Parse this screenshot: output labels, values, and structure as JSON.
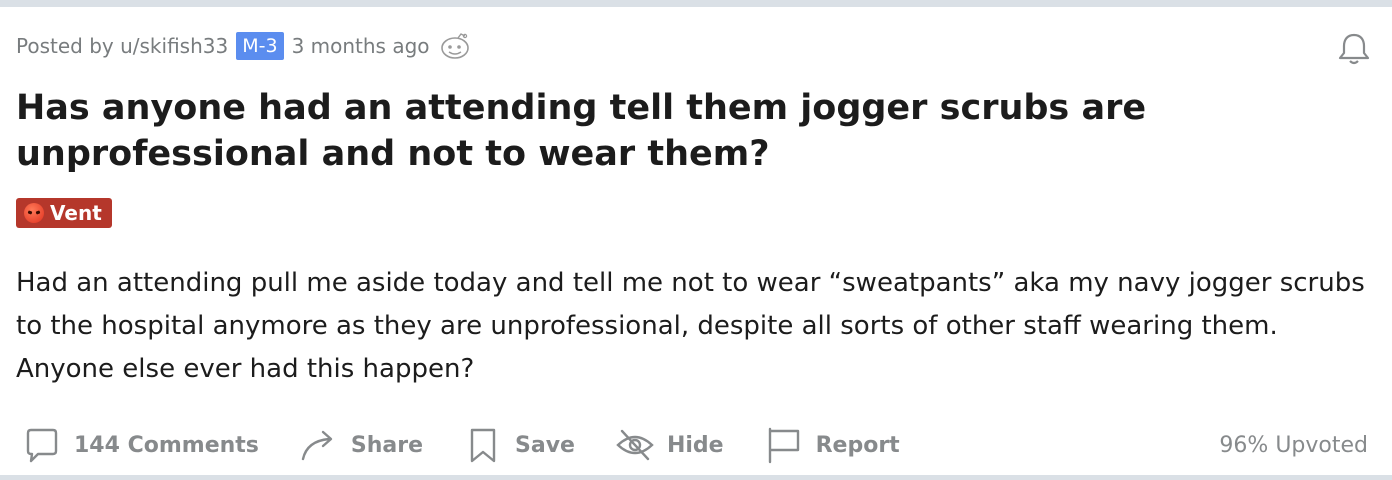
{
  "post": {
    "meta": {
      "posted_by": "Posted by u/skifish33",
      "user_flair": "M-3",
      "time_ago": "3 months ago"
    },
    "title": "Has anyone had an attending tell them jogger scrubs are unprofessional and not to wear them?",
    "flair": "Vent",
    "body_lines": [
      "Had an attending pull me aside today and tell me not to wear “sweatpants” aka my navy jogger scrubs",
      "to the hospital anymore as they are unprofessional, despite all sorts of other staff wearing them.",
      "Anyone else ever had this happen?"
    ]
  },
  "actions": {
    "comments": "144 Comments",
    "share": "Share",
    "save": "Save",
    "hide": "Hide",
    "report": "Report",
    "upvoted": "96% Upvoted"
  },
  "colors": {
    "user_flair_bg": "#5b8def",
    "post_flair_bg": "#b5372b",
    "muted_text": "#878a8c",
    "page_bg": "#dae0e6"
  },
  "icons": [
    "snoo-avatar-icon",
    "bell-icon",
    "angry-face-icon",
    "comment-icon",
    "share-icon",
    "save-icon",
    "hide-icon",
    "report-icon"
  ]
}
